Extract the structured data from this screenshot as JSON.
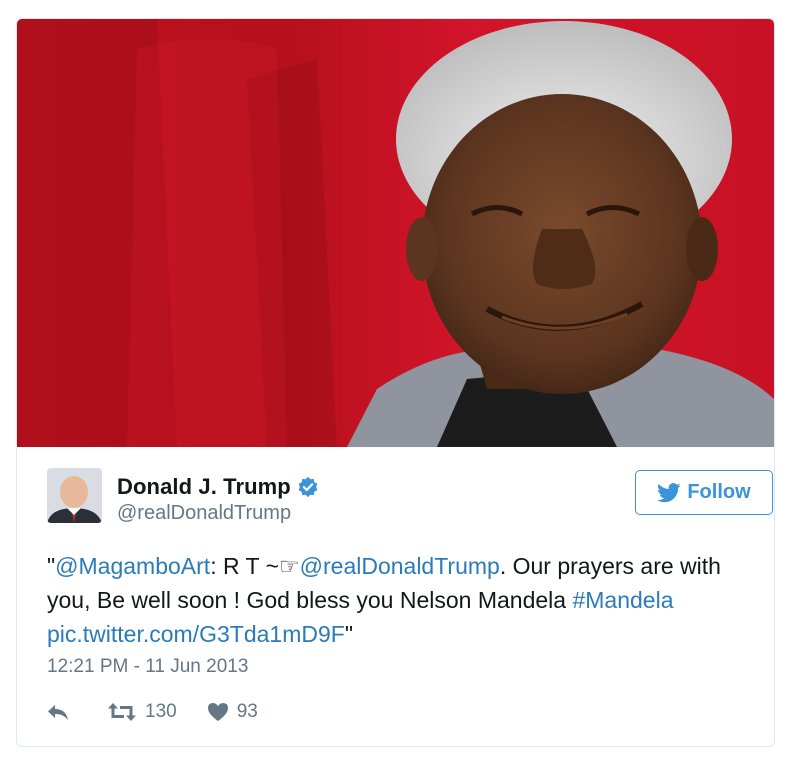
{
  "user": {
    "name": "Donald J. Trump",
    "handle": "@realDonaldTrump"
  },
  "follow_label": "Follow",
  "tweet": {
    "open_quote": "\"",
    "mention_1": "@MagamboArt",
    "mid_1": ":  R T ~☞",
    "mention_2": "@realDonaldTrump",
    "body": ". Our prayers are with you, Be well soon ! God bless you Nelson Mandela ",
    "hashtag": "#Mandela",
    "space": " ",
    "pic_link": "pic.twitter.com/G3Tda1mD9F",
    "close_quote": "\""
  },
  "timestamp": "12:21 PM - 11 Jun 2013",
  "stats": {
    "retweets": "130",
    "likes": "93"
  },
  "icons": {
    "reply": "reply-icon",
    "retweet": "retweet-icon",
    "like": "heart-icon",
    "verified": "verified-badge-icon",
    "bird": "twitter-bird-icon"
  },
  "colors": {
    "link": "#2b7bb9",
    "follow": "#3b94d9",
    "secondary_text": "#657786",
    "photo_background": "#c8102e"
  }
}
